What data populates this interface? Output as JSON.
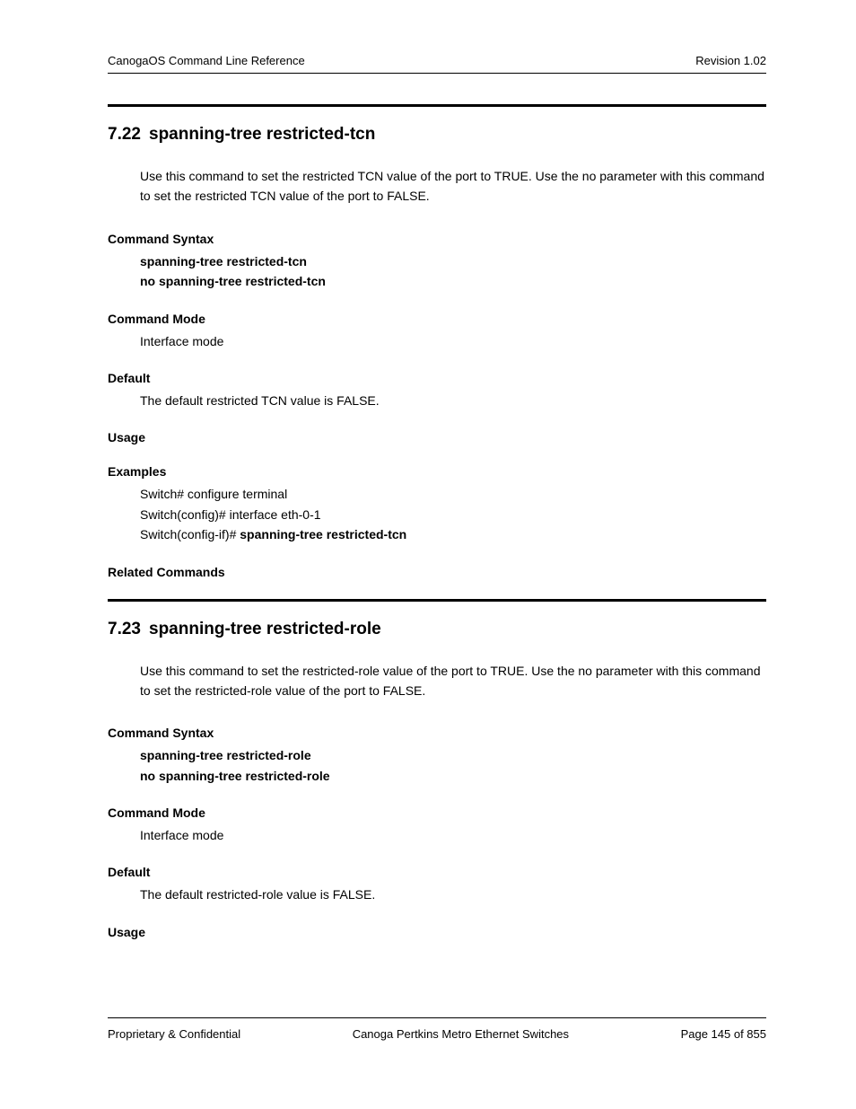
{
  "header": {
    "left": "CanogaOS Command Line Reference",
    "right": "Revision 1.02"
  },
  "sections": [
    {
      "num": "7.22",
      "title": "spanning-tree restricted-tcn",
      "intro": "Use this command to set the restricted TCN value of the port to TRUE. Use the no parameter with this command to set the restricted TCN value of the port to FALSE.",
      "syntax": {
        "label": "Command Syntax",
        "line1": "spanning-tree restricted-tcn",
        "line2": "no spanning-tree restricted-tcn"
      },
      "mode": {
        "label": "Command Mode",
        "text": "Interface mode"
      },
      "default": {
        "label": "Default",
        "text": "The default restricted TCN value is FALSE."
      },
      "usage": {
        "label": "Usage"
      },
      "examples": {
        "label": "Examples",
        "line1": "Switch# configure terminal",
        "line2": "Switch(config)# interface eth-0-1",
        "line3_prefix": "Switch(config-if)# ",
        "line3_bold": "spanning-tree restricted-tcn"
      },
      "related": {
        "label": "Related Commands"
      }
    },
    {
      "num": "7.23",
      "title": "spanning-tree restricted-role",
      "intro": "Use this command to set the restricted-role value of the port to TRUE. Use the no parameter with this command to set the restricted-role value of the port to FALSE.",
      "syntax": {
        "label": "Command Syntax",
        "line1": "spanning-tree restricted-role",
        "line2": "no spanning-tree restricted-role"
      },
      "mode": {
        "label": "Command Mode",
        "text": "Interface mode"
      },
      "default": {
        "label": "Default",
        "text": "The default restricted-role value is FALSE."
      },
      "usage": {
        "label": "Usage"
      }
    }
  ],
  "footer": {
    "left": "Proprietary & Confidential",
    "center": "Canoga Pertkins Metro Ethernet Switches",
    "right": "Page 145 of 855"
  }
}
